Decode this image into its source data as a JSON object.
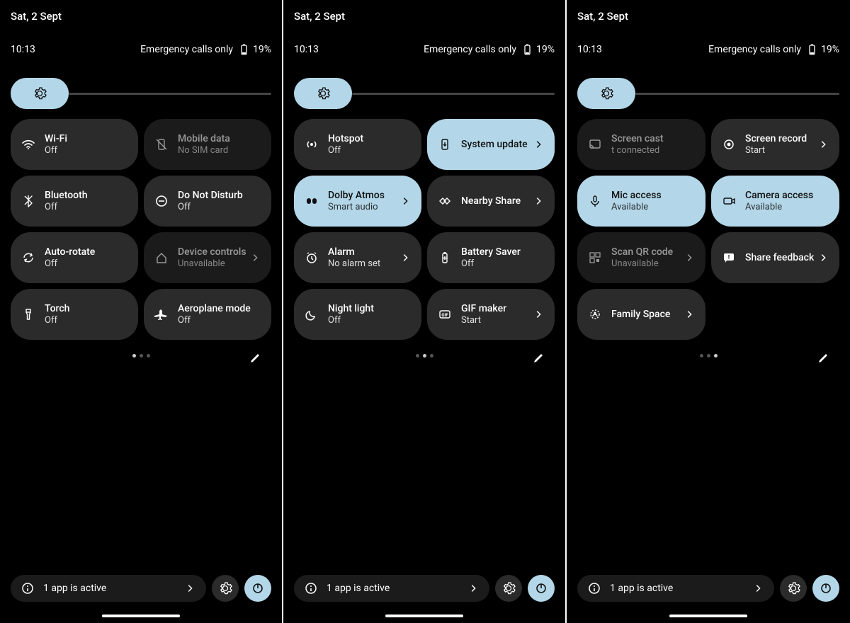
{
  "date": "Sat, 2 Sept",
  "time": "10:13",
  "emergency": "Emergency calls only",
  "battery": "19%",
  "active_apps": "1 app is active",
  "panels": [
    {
      "page_index": 0,
      "tiles": [
        {
          "icon": "wifi",
          "title": "Wi-Fi",
          "sub": "Off",
          "style": "dark",
          "chev": false
        },
        {
          "icon": "mobile-data",
          "title": "Mobile data",
          "sub": "No SIM card",
          "style": "darker",
          "chev": false
        },
        {
          "icon": "bluetooth",
          "title": "Bluetooth",
          "sub": "Off",
          "style": "dark",
          "chev": false
        },
        {
          "icon": "dnd",
          "title": "Do Not Disturb",
          "sub": "Off",
          "style": "dark",
          "chev": false
        },
        {
          "icon": "rotate",
          "title": "Auto-rotate",
          "sub": "Off",
          "style": "dark",
          "chev": false
        },
        {
          "icon": "home",
          "title": "Device controls",
          "sub": "Unavailable",
          "style": "darker",
          "chev": true
        },
        {
          "icon": "torch",
          "title": "Torch",
          "sub": "Off",
          "style": "dark",
          "chev": false
        },
        {
          "icon": "plane",
          "title": "Aeroplane mode",
          "sub": "Off",
          "style": "dark",
          "chev": false
        }
      ]
    },
    {
      "page_index": 1,
      "tiles": [
        {
          "icon": "hotspot",
          "title": "Hotspot",
          "sub": "Off",
          "style": "dark",
          "chev": false
        },
        {
          "icon": "update",
          "title": "System update",
          "sub": "",
          "style": "accent",
          "chev": true
        },
        {
          "icon": "dolby",
          "title": "Dolby Atmos",
          "sub": "Smart audio",
          "style": "accent",
          "chev": true
        },
        {
          "icon": "nearby",
          "title": "Nearby Share",
          "sub": "",
          "style": "dark",
          "chev": true
        },
        {
          "icon": "alarm",
          "title": "Alarm",
          "sub": "No alarm set",
          "style": "dark",
          "chev": true
        },
        {
          "icon": "battery-saver",
          "title": "Battery Saver",
          "sub": "Off",
          "style": "dark",
          "chev": false
        },
        {
          "icon": "night",
          "title": "Night light",
          "sub": "Off",
          "style": "dark",
          "chev": false
        },
        {
          "icon": "gif",
          "title": "GIF maker",
          "sub": "Start",
          "style": "dark",
          "chev": true
        }
      ]
    },
    {
      "page_index": 2,
      "tiles": [
        {
          "icon": "cast",
          "title": "Screen cast",
          "sub": "t connected",
          "style": "darker",
          "chev": false
        },
        {
          "icon": "record",
          "title": "Screen record",
          "sub": "Start",
          "style": "dark",
          "chev": true
        },
        {
          "icon": "mic",
          "title": "Mic access",
          "sub": "Available",
          "style": "accent",
          "chev": false
        },
        {
          "icon": "camera",
          "title": "Camera access",
          "sub": "Available",
          "style": "accent",
          "chev": false
        },
        {
          "icon": "qr",
          "title": "Scan QR code",
          "sub": "Unavailable",
          "style": "darker",
          "chev": true
        },
        {
          "icon": "feedback",
          "title": "Share feedback",
          "sub": "",
          "style": "dark",
          "chev": true
        },
        {
          "icon": "family",
          "title": "Family Space",
          "sub": "",
          "style": "dark",
          "chev": true
        }
      ]
    }
  ]
}
